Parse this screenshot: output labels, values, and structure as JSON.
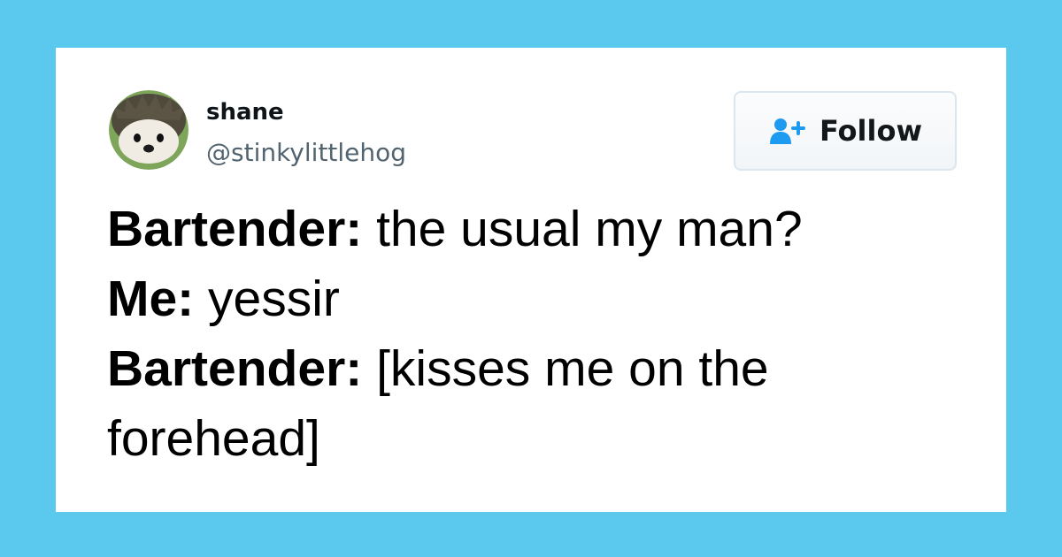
{
  "colors": {
    "page_background": "#5bc8ee",
    "card_background": "#ffffff",
    "handle_text": "#536471",
    "follow_icon": "#1d9bf0"
  },
  "author": {
    "name": "shane",
    "handle": "@stinkylittlehog",
    "avatar": "hedgehog-avatar"
  },
  "follow_button": {
    "label": "Follow",
    "icon": "add-user-icon"
  },
  "tweet": {
    "lines": [
      {
        "speaker": "Bartender:",
        "text": " the usual my man?"
      },
      {
        "speaker": "Me:",
        "text": " yessir"
      },
      {
        "speaker": "Bartender:",
        "text": " [kisses me on the"
      },
      {
        "speaker": "",
        "text": "forehead]"
      }
    ]
  }
}
